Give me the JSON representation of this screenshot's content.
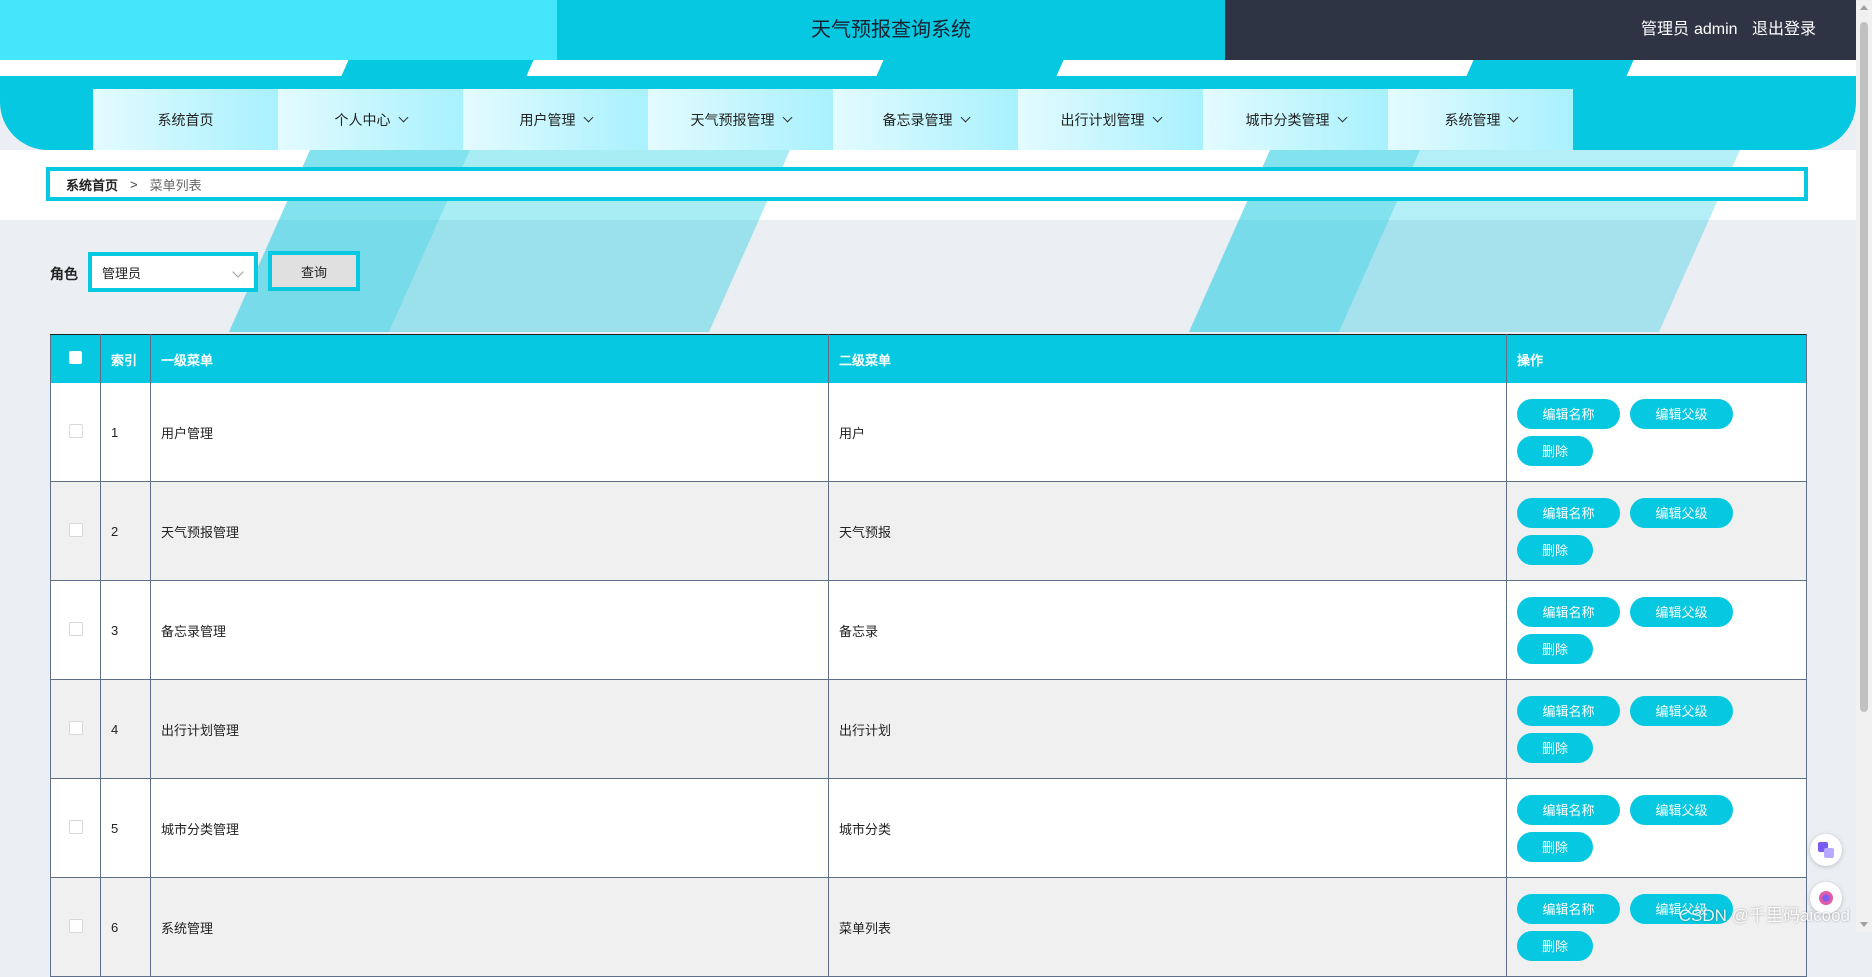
{
  "header": {
    "system_title": "天气预报查询系统",
    "role_label": "管理员",
    "username": "admin",
    "logout_label": "退出登录"
  },
  "nav": {
    "items": [
      {
        "label": "系统首页"
      },
      {
        "label": "个人中心"
      },
      {
        "label": "用户管理"
      },
      {
        "label": "天气预报管理"
      },
      {
        "label": "备忘录管理"
      },
      {
        "label": "出行计划管理"
      },
      {
        "label": "城市分类管理"
      },
      {
        "label": "系统管理"
      }
    ]
  },
  "breadcrumb": {
    "home": "系统首页",
    "separator": ">",
    "current": "菜单列表"
  },
  "filter": {
    "label": "角色",
    "selected": "管理员",
    "query_button": "查询"
  },
  "table": {
    "columns": [
      "索引",
      "一级菜单",
      "二级菜单",
      "操作"
    ],
    "rows": [
      {
        "index": "1",
        "level1": "用户管理",
        "level2": "用户"
      },
      {
        "index": "2",
        "level1": "天气预报管理",
        "level2": "天气预报"
      },
      {
        "index": "3",
        "level1": "备忘录管理",
        "level2": "备忘录"
      },
      {
        "index": "4",
        "level1": "出行计划管理",
        "level2": "出行计划"
      },
      {
        "index": "5",
        "level1": "城市分类管理",
        "level2": "城市分类"
      },
      {
        "index": "6",
        "level1": "系统管理",
        "level2": "菜单列表"
      }
    ],
    "actions": {
      "edit_name": "编辑名称",
      "edit_parent": "编辑父级",
      "delete": "删除"
    }
  },
  "watermark": "CSDN @千里码aicood",
  "colors": {
    "primary": "#06c8e0",
    "light": "#43e6fb",
    "dark": "#2e3444"
  }
}
